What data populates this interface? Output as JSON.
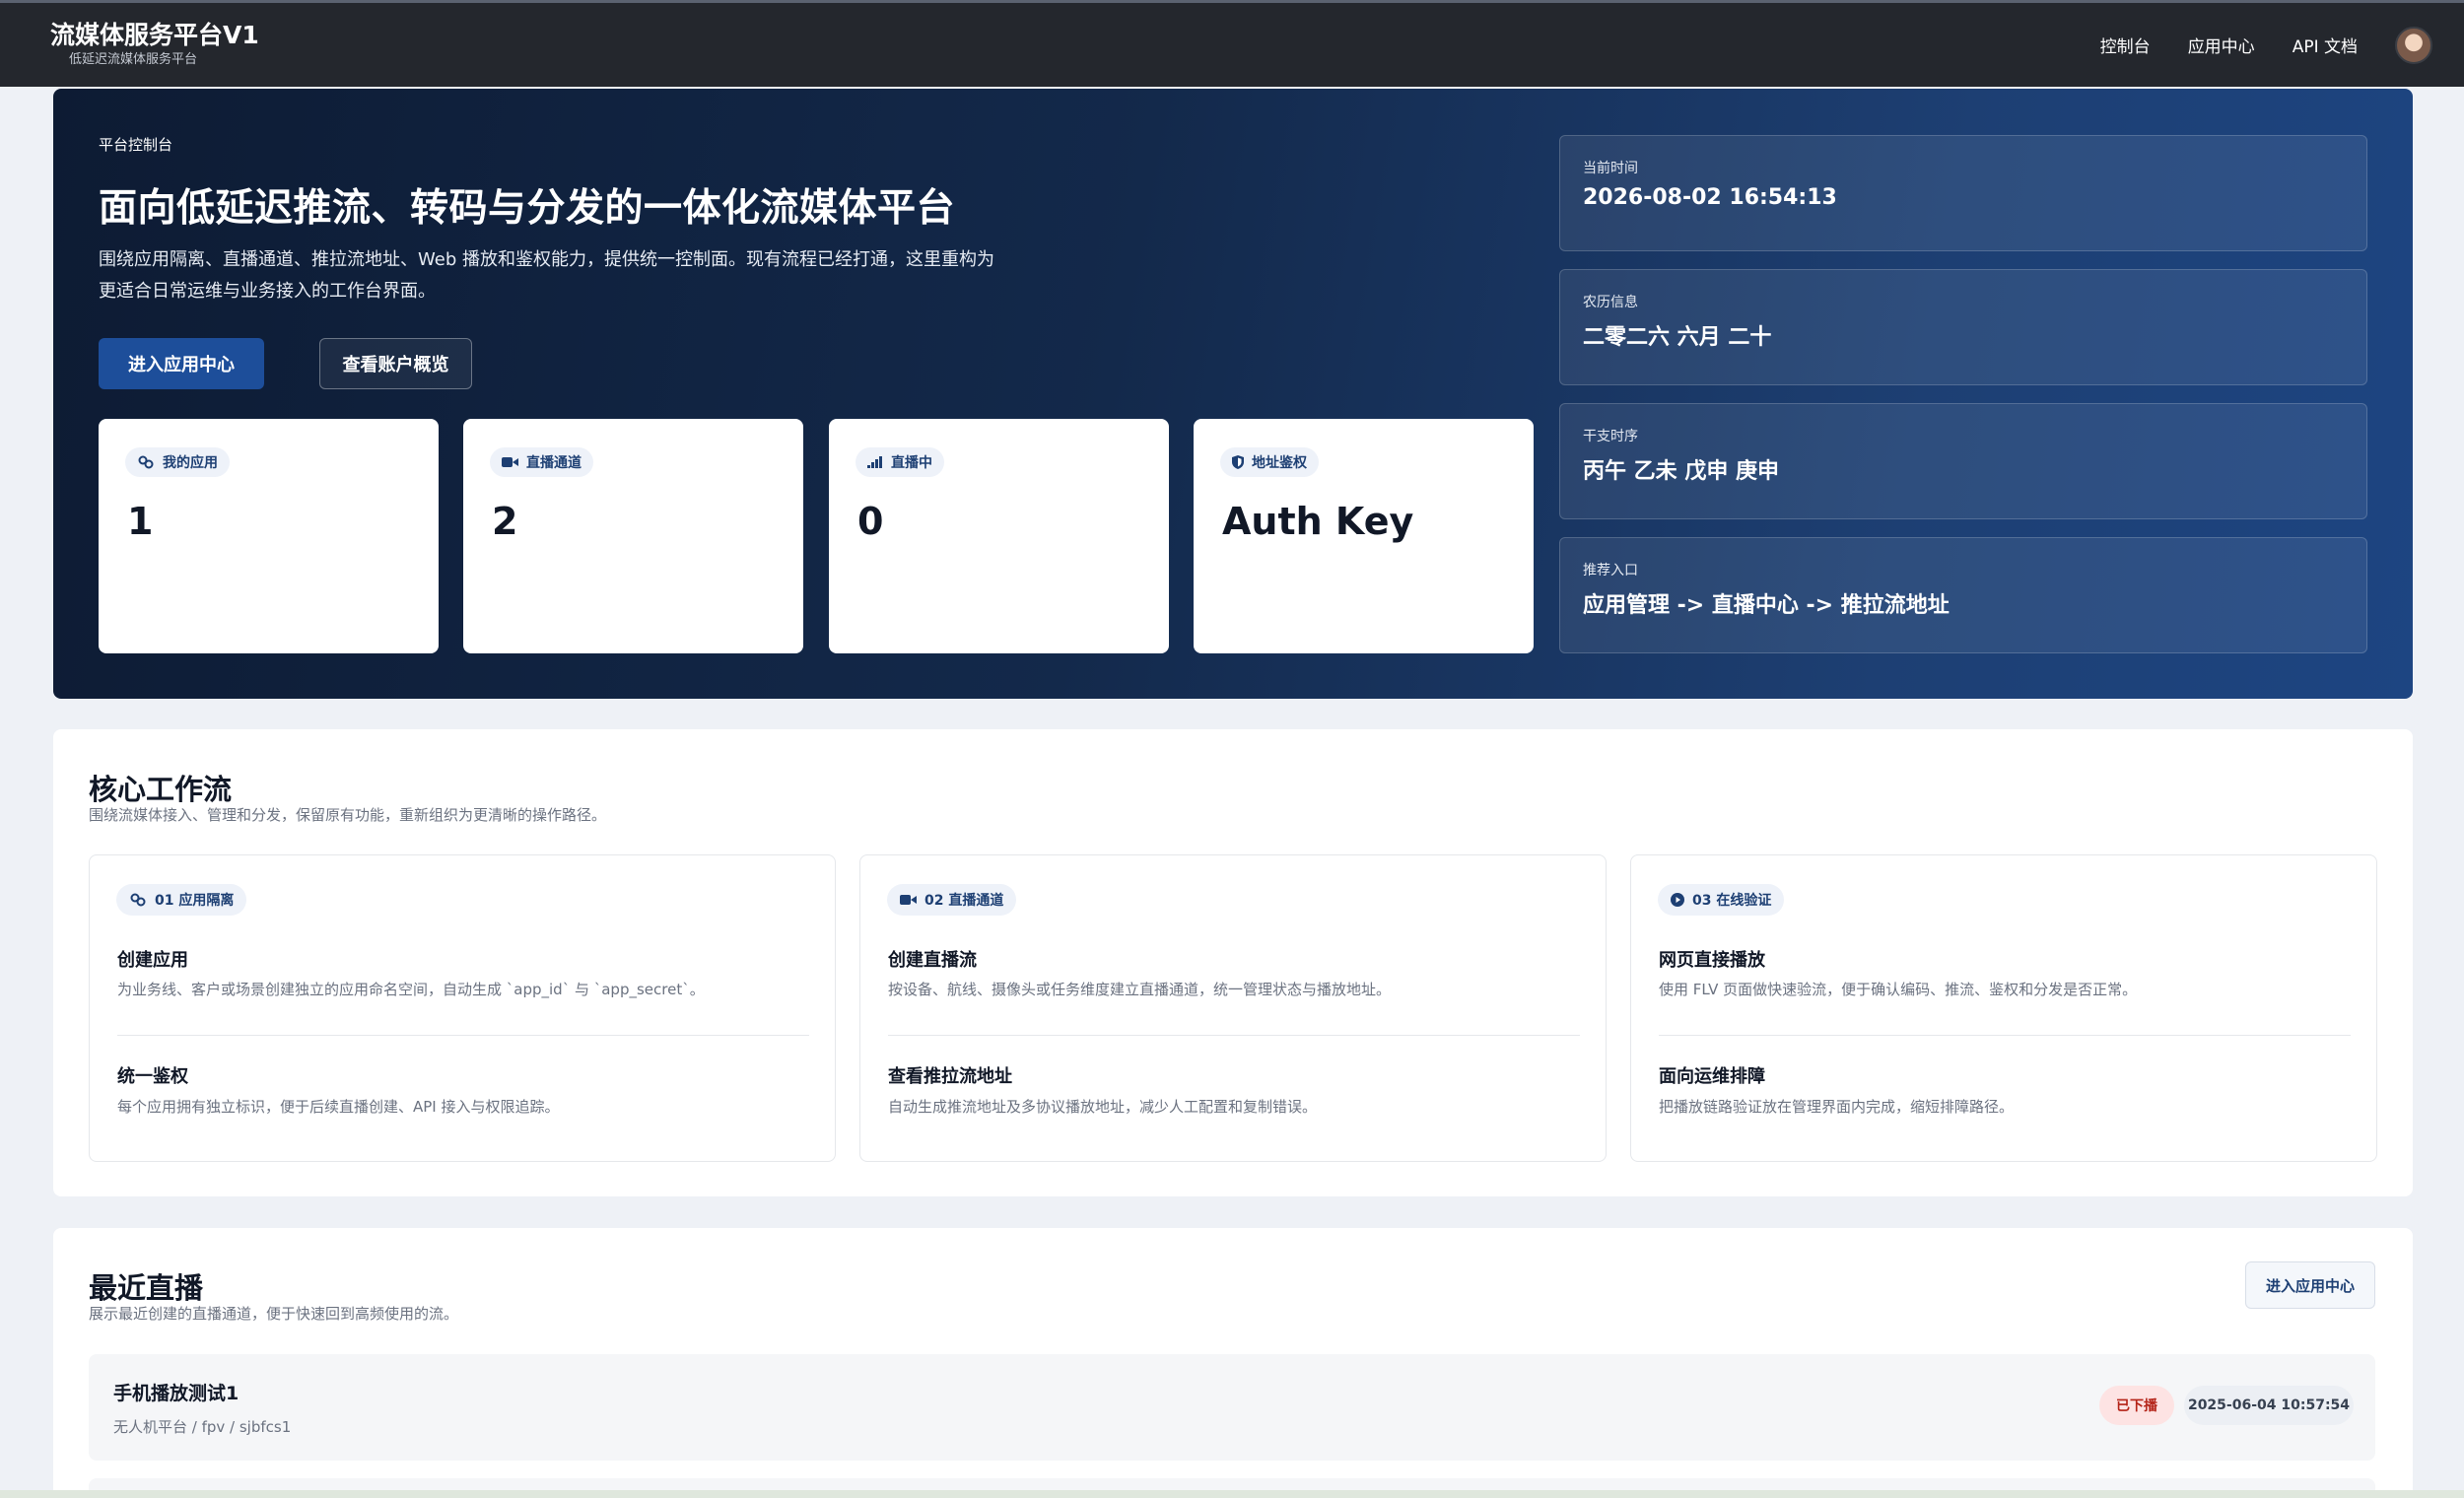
{
  "header": {
    "title": "流媒体服务平台V1",
    "subtitle": "低延迟流媒体服务平台",
    "nav": [
      "控制台",
      "应用中心",
      "API 文档"
    ]
  },
  "hero": {
    "eyebrow": "平台控制台",
    "title": "面向低延迟推流、转码与分发的一体化流媒体平台",
    "description": "围绕应用隔离、直播通道、推拉流地址、Web 播放和鉴权能力，提供统一控制面。现有流程已经打通，这里重构为更适合日常运维与业务接入的工作台界面。",
    "primary_button": "进入应用中心",
    "secondary_button": "查看账户概览",
    "stats": [
      {
        "label": "我的应用",
        "value": "1",
        "icon": "apps-icon"
      },
      {
        "label": "直播通道",
        "value": "2",
        "icon": "camera-icon"
      },
      {
        "label": "直播中",
        "value": "0",
        "icon": "signal-icon"
      },
      {
        "label": "地址鉴权",
        "value": "Auth Key",
        "icon": "shield-icon"
      }
    ],
    "info": [
      {
        "label": "当前时间",
        "value": "2026-08-02 16:54:13"
      },
      {
        "label": "农历信息",
        "value": "二零二六 六月 二十"
      },
      {
        "label": "干支时序",
        "value": "丙午 乙未 戊申 庚申"
      },
      {
        "label": "推荐入口",
        "value": "应用管理 -> 直播中心 -> 推拉流地址"
      }
    ]
  },
  "workflow": {
    "title": "核心工作流",
    "subtitle": "围绕流媒体接入、管理和分发，保留原有功能，重新组织为更清晰的操作路径。",
    "cards": [
      {
        "tag": "01 应用隔离",
        "icon": "apps-icon",
        "items": [
          {
            "title": "创建应用",
            "desc": "为业务线、客户或场景创建独立的应用命名空间，自动生成 `app_id` 与 `app_secret`。"
          },
          {
            "title": "统一鉴权",
            "desc": "每个应用拥有独立标识，便于后续直播创建、API 接入与权限追踪。"
          }
        ]
      },
      {
        "tag": "02 直播通道",
        "icon": "camera-icon",
        "items": [
          {
            "title": "创建直播流",
            "desc": "按设备、航线、摄像头或任务维度建立直播通道，统一管理状态与播放地址。"
          },
          {
            "title": "查看推拉流地址",
            "desc": "自动生成推流地址及多协议播放地址，减少人工配置和复制错误。"
          }
        ]
      },
      {
        "tag": "03 在线验证",
        "icon": "play-icon",
        "items": [
          {
            "title": "网页直接播放",
            "desc": "使用 FLV 页面做快速验流，便于确认编码、推流、鉴权和分发是否正常。"
          },
          {
            "title": "面向运维排障",
            "desc": "把播放链路验证放在管理界面内完成，缩短排障路径。"
          }
        ]
      }
    ]
  },
  "recent": {
    "title": "最近直播",
    "subtitle": "展示最近创建的直播通道，便于快速回到高频使用的流。",
    "button": "进入应用中心",
    "rows": [
      {
        "name": "手机播放测试1",
        "path": "无人机平台 / fpv / sjbfcs1",
        "status": "已下播",
        "time": "2025-06-04 10:57:54"
      }
    ]
  },
  "colors": {
    "accent": "#1d4e9a",
    "topbar": "#24272d",
    "status_offline_bg": "#fde3e3",
    "status_offline_text": "#b42318"
  }
}
